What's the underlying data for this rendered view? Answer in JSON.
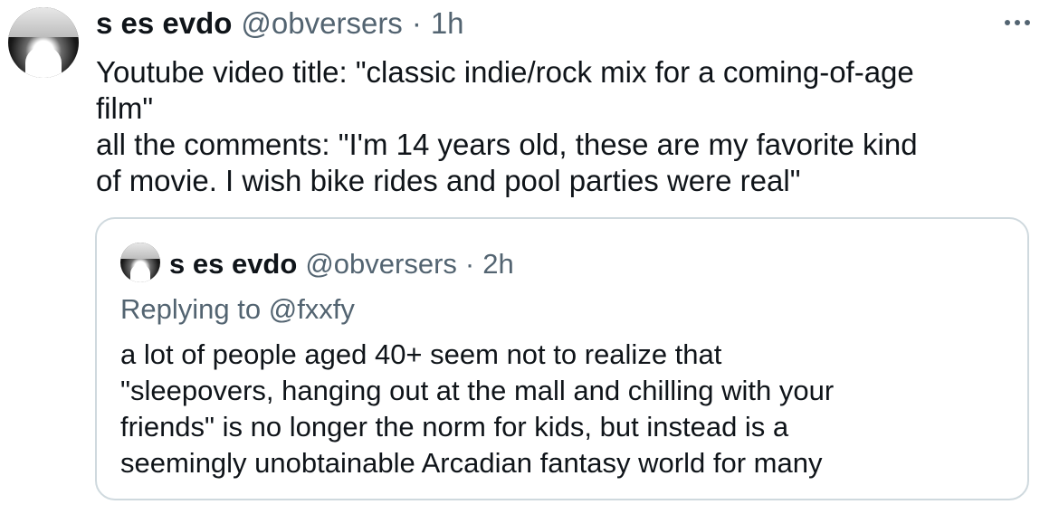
{
  "tweet": {
    "author_name": "s es evdo",
    "author_handle": "@obversers",
    "separator": "·",
    "time": "1h",
    "more_icon": "more-horizontal-icon",
    "text_lines": [
      "Youtube video title: \"classic indie/rock mix for a coming-of-age",
      "film\"",
      "all the comments: \"I'm 14 years old, these are my favorite kind",
      "of movie. I wish bike rides and pool parties were real\""
    ]
  },
  "quoted": {
    "author_name": "s es evdo",
    "author_handle": "@obversers",
    "separator": "·",
    "time": "2h",
    "replying_prefix": "Replying to",
    "replying_to": "@fxxfy",
    "text_lines": [
      "a lot of people aged 40+ seem not to realize that",
      "\"sleepovers, hanging out at the mall and chilling with your",
      "friends\" is no longer the norm for kids, but instead is a",
      "seemingly unobtainable Arcadian fantasy world for many"
    ]
  },
  "colors": {
    "text": "#0f1419",
    "secondary": "#536471",
    "border": "#cfd9de",
    "background": "#ffffff"
  }
}
